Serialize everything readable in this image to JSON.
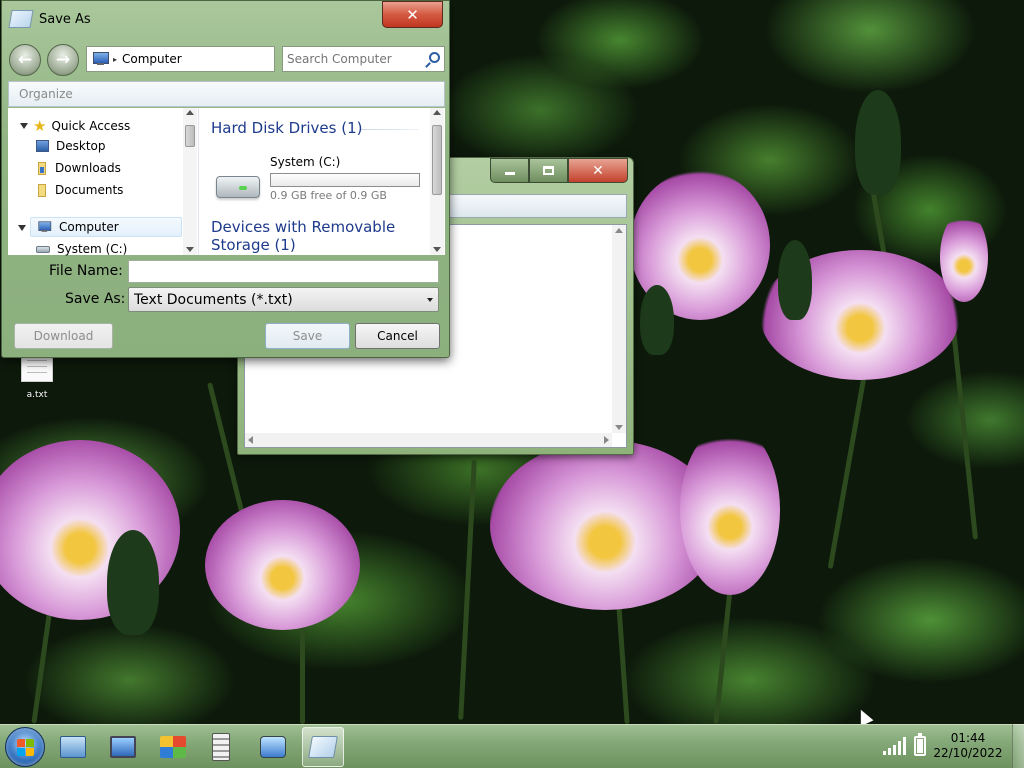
{
  "desktop": {
    "icon_label": "a.txt"
  },
  "dialog": {
    "title": "Save As",
    "close_glyph": "✕",
    "back_glyph": "←",
    "forward_glyph": "→",
    "address": {
      "separator": "▸",
      "location": "Computer"
    },
    "search_placeholder": "Search Computer",
    "toolbar": {
      "organize_label": "Organize"
    },
    "nav_tree": {
      "quick_access": "Quick Access",
      "desktop": "Desktop",
      "downloads": "Downloads",
      "documents": "Documents",
      "computer": "Computer",
      "system_drive": "System (C:)"
    },
    "content": {
      "group_hdd": "Hard Disk Drives (1)",
      "drive_name": "System (C:)",
      "drive_free": "0.9 GB free of 0.9 GB",
      "drive_used_fraction": 0,
      "group_removable_line1": "Devices with Removable",
      "group_removable_line2": "Storage (1)"
    },
    "file_name_label": "File Name:",
    "file_name_value": "",
    "save_as_label": "Save As:",
    "save_as_type": "Text Documents (*.txt)",
    "buttons": {
      "download": "Download",
      "save": "Save",
      "cancel": "Cancel"
    }
  },
  "taskbar": {
    "clock_time": "01:44",
    "clock_date": "22/10/2022"
  },
  "icons": {
    "start": "windows-logo-icon",
    "app1": "control-panel-icon",
    "app2": "computer-icon",
    "app3": "media-icon",
    "app4": "server-icon",
    "app5": "network-icon",
    "app6": "notepad-icon"
  },
  "colors": {
    "window_frame": "#91b483",
    "close_red": "#c3422d",
    "link_blue": "#1e3b8c"
  }
}
